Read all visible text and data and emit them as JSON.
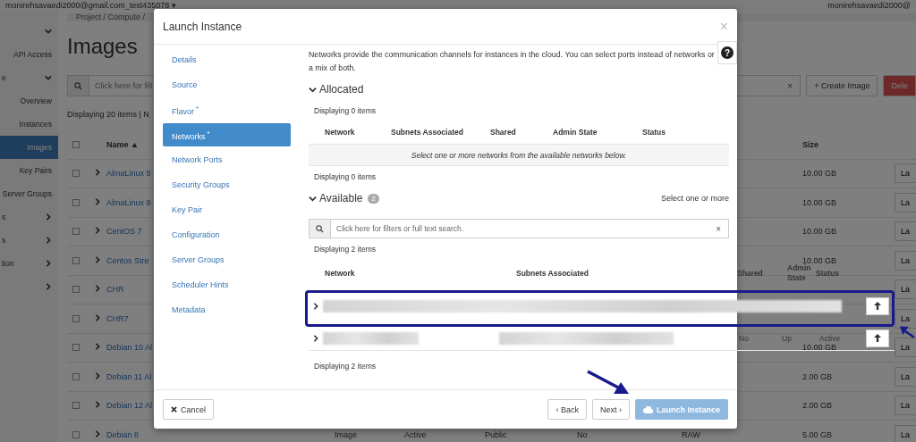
{
  "top_bar": {
    "project_menu": "monirehsavaedi2000@gmail.com_test435078 ▾",
    "user_menu": "monirehsavaedi2000@"
  },
  "sidebar": {
    "items": [
      {
        "kind": "group"
      },
      {
        "kind": "link",
        "label": "API Access",
        "selected": false
      },
      {
        "kind": "group",
        "label": "e"
      },
      {
        "kind": "link",
        "label": "Overview",
        "selected": false
      },
      {
        "kind": "link",
        "label": "Instances",
        "selected": false
      },
      {
        "kind": "link",
        "label": "Images",
        "selected": true
      },
      {
        "kind": "link",
        "label": "Key Pairs",
        "selected": false
      },
      {
        "kind": "link",
        "label": "Server Groups",
        "selected": false
      },
      {
        "kind": "section",
        "label": "s"
      },
      {
        "kind": "section",
        "label": "s"
      },
      {
        "kind": "section",
        "label": "tion"
      },
      {
        "kind": "section"
      }
    ]
  },
  "page": {
    "breadcrumb": "Project / Compute /",
    "title": "Images",
    "search_placeholder": "Click here for filt",
    "clear": "×",
    "select_all_checked": false,
    "count": "Displaying 20 items | N",
    "create_button": "+ Create Image",
    "delete_button": "Dele",
    "columns": {
      "name": "Name ▲",
      "size": "Size"
    },
    "rows": [
      {
        "name": "AlmaLinux 8",
        "checked": false,
        "size": "10.00 GB",
        "action": "La"
      },
      {
        "name": "AlmaLinux 9",
        "checked": false,
        "size": "10.00 GB",
        "action": "La"
      },
      {
        "name": "CentOS 7",
        "checked": false,
        "size": "10.00 GB",
        "action": "La"
      },
      {
        "name": "Centos Stre",
        "checked": false,
        "size": "10.00 GB",
        "action": "La"
      },
      {
        "name": "CHR",
        "checked": false,
        "action": "La"
      },
      {
        "name": "CHR7",
        "checked": false,
        "action": "La"
      },
      {
        "name": "Debian 10 Al",
        "checked": false,
        "size": "10.00 GB",
        "action": "La"
      },
      {
        "name": "Debian 11 Al",
        "checked": false,
        "size": "2.00 GB",
        "action": "La"
      },
      {
        "name": "Debian 12 Al",
        "checked": false,
        "size": "2.00 GB",
        "action": "La"
      },
      {
        "name": "Debian 8",
        "checked": false,
        "type": "Image",
        "status": "Active",
        "visibility": "Public",
        "protected": "No",
        "format": "RAW",
        "size": "5.00 GB",
        "action": "La"
      }
    ]
  },
  "modal": {
    "title": "Launch Instance",
    "close": "×",
    "help": "?",
    "required_mark": "*",
    "steps": [
      {
        "label": "Details",
        "required": false,
        "selected": false
      },
      {
        "label": "Source",
        "required": false,
        "selected": false
      },
      {
        "label": "Flavor",
        "required": true,
        "selected": false
      },
      {
        "label": "Networks",
        "required": true,
        "selected": true
      },
      {
        "label": "Network Ports",
        "required": false,
        "selected": false
      },
      {
        "label": "Security Groups",
        "required": false,
        "selected": false
      },
      {
        "label": "Key Pair",
        "required": false,
        "selected": false
      },
      {
        "label": "Configuration",
        "required": false,
        "selected": false
      },
      {
        "label": "Server Groups",
        "required": false,
        "selected": false
      },
      {
        "label": "Scheduler Hints",
        "required": false,
        "selected": false
      },
      {
        "label": "Metadata",
        "required": false,
        "selected": false
      }
    ],
    "description": "Networks provide the communication channels for instances in the cloud. You can select ports instead of networks or a mix of both.",
    "allocated": {
      "title": "Allocated",
      "count_top": "Displaying 0 items",
      "columns": [
        "Network",
        "Subnets Associated",
        "Shared",
        "Admin State",
        "Status"
      ],
      "empty": "Select one or more networks from the available networks below.",
      "count_bottom": "Displaying 0 items"
    },
    "available": {
      "title": "Available",
      "badge": "2",
      "hint": "Select one or more",
      "search_placeholder": "Click here for filters or full text search.",
      "clear": "×",
      "count_top": "Displaying 2 items",
      "columns": [
        "Network",
        "Subnets Associated",
        "Shared",
        "Admin State",
        "Status"
      ],
      "rows": [
        {
          "kind": "redacted-wide",
          "highlighted": true
        },
        {
          "kind": "redacted",
          "highlighted": false,
          "shared": "No",
          "admin_state": "Up",
          "status": "Active"
        }
      ],
      "count_bottom": "Displaying 2 items"
    },
    "footer": {
      "cancel": "Cancel",
      "back": "‹ Back",
      "next": "Next ›",
      "launch": "Launch Instance",
      "launch_disabled": true
    }
  }
}
